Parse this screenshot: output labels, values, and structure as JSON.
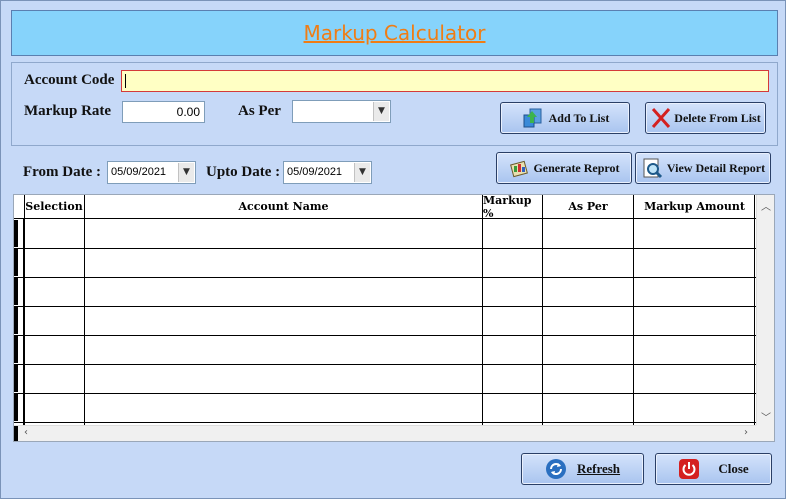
{
  "title": "Markup Calculator",
  "form": {
    "account_code_label": "Account Code",
    "account_code_value": "",
    "markup_rate_label": "Markup Rate",
    "markup_rate_value": "0.00",
    "as_per_label": "As Per",
    "as_per_value": "",
    "from_date_label": "From Date :",
    "from_date_value": "05/09/2021",
    "upto_date_label": "Upto Date :",
    "upto_date_value": "05/09/2021"
  },
  "buttons": {
    "add_to_list": "Add To List",
    "delete_from_list": "Delete From List",
    "generate_report": "Generate Reprot",
    "view_detail_report": "View Detail Report",
    "refresh": "Refresh",
    "close": "Close"
  },
  "grid": {
    "columns": [
      "Selection",
      "Account Name",
      "Markup %",
      "As Per",
      "Markup Amount"
    ],
    "rows": [
      [
        "",
        "",
        "",
        "",
        ""
      ],
      [
        "",
        "",
        "",
        "",
        ""
      ],
      [
        "",
        "",
        "",
        "",
        ""
      ],
      [
        "",
        "",
        "",
        "",
        ""
      ],
      [
        "",
        "",
        "",
        "",
        ""
      ],
      [
        "",
        "",
        "",
        "",
        ""
      ],
      [
        "",
        "",
        "",
        "",
        ""
      ]
    ]
  },
  "icons": {
    "add": "add-list-icon",
    "delete": "red-x-icon",
    "generate": "report-icon",
    "view": "magnifier-icon",
    "refresh": "refresh-icon",
    "close": "power-icon"
  },
  "colors": {
    "title_text": "#f07d14",
    "title_bg": "#86d3fb",
    "window_bg": "#c6d9f7",
    "account_input_bg": "#ffffc4"
  }
}
